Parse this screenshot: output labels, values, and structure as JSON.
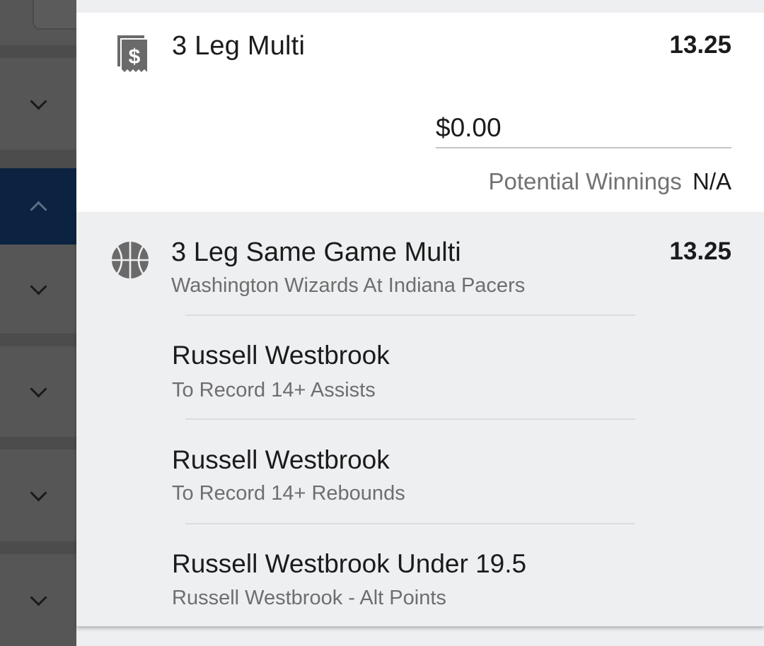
{
  "sidebar": {
    "items": [
      {
        "icon": "chevron-down-icon",
        "active": false
      },
      {
        "icon": "chevron-up-icon",
        "active": true
      },
      {
        "icon": "chevron-down-icon",
        "active": false
      },
      {
        "icon": "chevron-down-icon",
        "active": false
      },
      {
        "icon": "chevron-down-icon",
        "active": false
      },
      {
        "icon": "chevron-down-icon",
        "active": false
      }
    ],
    "active_color": "#0b2340"
  },
  "multi": {
    "icon": "receipt-dollar-icon",
    "title": "3 Leg Multi",
    "odds": "13.25",
    "stake_value": "$0.00",
    "potential_winnings_label": "Potential Winnings",
    "potential_winnings_value": "N/A"
  },
  "same_game_multi": {
    "icon": "basketball-icon",
    "title": "3 Leg Same Game Multi",
    "odds": "13.25",
    "event": "Washington Wizards At Indiana Pacers",
    "legs": [
      {
        "selection": "Russell Westbrook",
        "market": "To Record 14+ Assists"
      },
      {
        "selection": "Russell Westbrook",
        "market": "To Record 14+ Rebounds"
      },
      {
        "selection": "Russell Westbrook Under 19.5",
        "market": "Russell Westbrook - Alt Points"
      }
    ]
  }
}
